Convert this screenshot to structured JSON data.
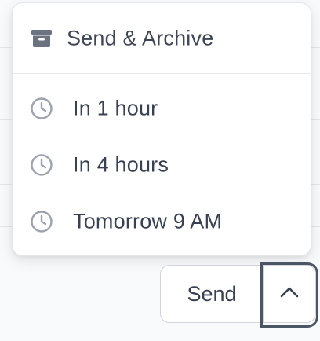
{
  "dropdown": {
    "items": [
      {
        "label": "Send & Archive",
        "icon": "archive-icon"
      },
      {
        "label": "In 1 hour",
        "icon": "clock-icon"
      },
      {
        "label": "In 4 hours",
        "icon": "clock-icon"
      },
      {
        "label": "Tomorrow 9 AM",
        "icon": "clock-icon"
      }
    ]
  },
  "send_group": {
    "send_label": "Send",
    "toggle_icon": "chevron-up-icon"
  },
  "colors": {
    "text": "#374151",
    "icon": "#9ca3af",
    "border": "#d1d5db",
    "focus_ring": "#4b5563"
  }
}
